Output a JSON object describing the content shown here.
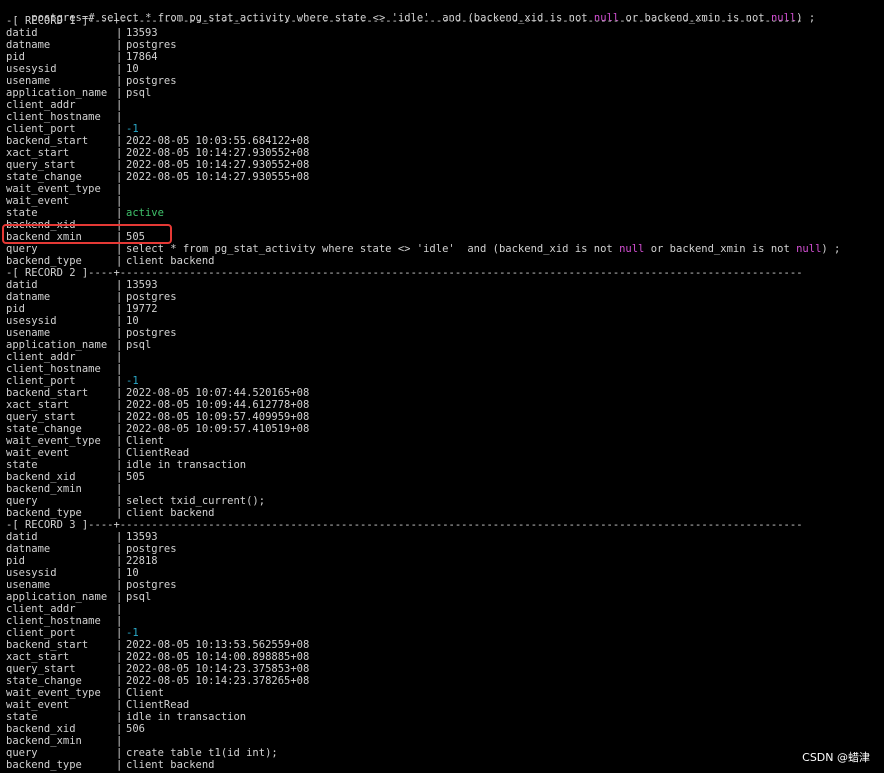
{
  "command": {
    "prompt": "postgres=#",
    "sql_before_null1": " select * from pg_stat_activity where state <> 'idle'  and (backend_xid is not ",
    "null1": "null",
    "sql_between_nulls": " or backend_xmin is not ",
    "null2": "null",
    "sql_after_null2": ") ;"
  },
  "separator_dashes": "------------------------------------------------------------------------------------------------------------",
  "records": [
    {
      "header": "-[ RECORD 1 ]----+",
      "fields": [
        {
          "key": "datid",
          "value": "13593"
        },
        {
          "key": "datname",
          "value": "postgres"
        },
        {
          "key": "pid",
          "value": "17864"
        },
        {
          "key": "usesysid",
          "value": "10"
        },
        {
          "key": "usename",
          "value": "postgres"
        },
        {
          "key": "application_name",
          "value": "psql"
        },
        {
          "key": "client_addr",
          "value": ""
        },
        {
          "key": "client_hostname",
          "value": ""
        },
        {
          "key": "client_port",
          "value": "-1",
          "color": "cyan"
        },
        {
          "key": "backend_start",
          "value": "2022-08-05 10:03:55.684122+08"
        },
        {
          "key": "xact_start",
          "value": "2022-08-05 10:14:27.930552+08"
        },
        {
          "key": "query_start",
          "value": "2022-08-05 10:14:27.930552+08"
        },
        {
          "key": "state_change",
          "value": "2022-08-05 10:14:27.930555+08"
        },
        {
          "key": "wait_event_type",
          "value": ""
        },
        {
          "key": "wait_event",
          "value": ""
        },
        {
          "key": "state",
          "value": "active",
          "color": "green"
        },
        {
          "key": "backend_xid",
          "value": ""
        },
        {
          "key": "backend_xmin",
          "value": "505"
        },
        {
          "key": "query",
          "value": "select * from pg_stat_activity where state <> 'idle'  and (backend_xid is not ",
          "null_tail": true
        },
        {
          "key": "backend_type",
          "value": "client backend"
        }
      ]
    },
    {
      "header": "-[ RECORD 2 ]----+",
      "fields": [
        {
          "key": "datid",
          "value": "13593"
        },
        {
          "key": "datname",
          "value": "postgres"
        },
        {
          "key": "pid",
          "value": "19772"
        },
        {
          "key": "usesysid",
          "value": "10"
        },
        {
          "key": "usename",
          "value": "postgres"
        },
        {
          "key": "application_name",
          "value": "psql"
        },
        {
          "key": "client_addr",
          "value": ""
        },
        {
          "key": "client_hostname",
          "value": ""
        },
        {
          "key": "client_port",
          "value": "-1",
          "color": "cyan"
        },
        {
          "key": "backend_start",
          "value": "2022-08-05 10:07:44.520165+08"
        },
        {
          "key": "xact_start",
          "value": "2022-08-05 10:09:44.612778+08"
        },
        {
          "key": "query_start",
          "value": "2022-08-05 10:09:57.409959+08"
        },
        {
          "key": "state_change",
          "value": "2022-08-05 10:09:57.410519+08"
        },
        {
          "key": "wait_event_type",
          "value": "Client"
        },
        {
          "key": "wait_event",
          "value": "ClientRead"
        },
        {
          "key": "state",
          "value": "idle in transaction"
        },
        {
          "key": "backend_xid",
          "value": "505"
        },
        {
          "key": "backend_xmin",
          "value": ""
        },
        {
          "key": "query",
          "value": "select txid_current();"
        },
        {
          "key": "backend_type",
          "value": "client backend"
        }
      ]
    },
    {
      "header": "-[ RECORD 3 ]----+",
      "fields": [
        {
          "key": "datid",
          "value": "13593"
        },
        {
          "key": "datname",
          "value": "postgres"
        },
        {
          "key": "pid",
          "value": "22818"
        },
        {
          "key": "usesysid",
          "value": "10"
        },
        {
          "key": "usename",
          "value": "postgres"
        },
        {
          "key": "application_name",
          "value": "psql"
        },
        {
          "key": "client_addr",
          "value": ""
        },
        {
          "key": "client_hostname",
          "value": ""
        },
        {
          "key": "client_port",
          "value": "-1",
          "color": "cyan"
        },
        {
          "key": "backend_start",
          "value": "2022-08-05 10:13:53.562559+08"
        },
        {
          "key": "xact_start",
          "value": "2022-08-05 10:14:00.898885+08"
        },
        {
          "key": "query_start",
          "value": "2022-08-05 10:14:23.375853+08"
        },
        {
          "key": "state_change",
          "value": "2022-08-05 10:14:23.378265+08"
        },
        {
          "key": "wait_event_type",
          "value": "Client"
        },
        {
          "key": "wait_event",
          "value": "ClientRead"
        },
        {
          "key": "state",
          "value": "idle in transaction"
        },
        {
          "key": "backend_xid",
          "value": "506"
        },
        {
          "key": "backend_xmin",
          "value": ""
        },
        {
          "key": "query",
          "value": "create table t1(id int);"
        },
        {
          "key": "backend_type",
          "value": "client backend"
        }
      ]
    }
  ],
  "query_null_tail": {
    "null1": "null",
    "between": " or backend_xmin is not ",
    "null2": "null",
    "after": ") ;"
  },
  "pipe_char": "|",
  "highlight": {
    "color": "#e53935",
    "target": "backend_xmin"
  },
  "colors": {
    "background": "#000000",
    "text": "#d2d2d2",
    "green": "#3fc26b",
    "cyan": "#2aa8c7",
    "null_keyword": "#d24fd2"
  },
  "watermark": "CSDN @蜡津"
}
